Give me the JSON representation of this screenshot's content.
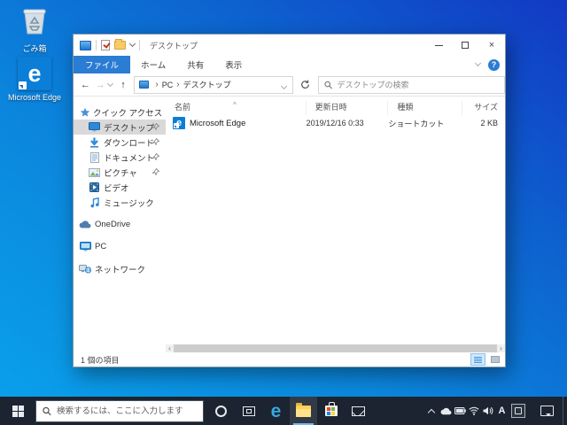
{
  "desktop": {
    "recycle_bin_label": "ごみ箱",
    "edge_label": "Microsoft Edge"
  },
  "explorer": {
    "title": "デスクトップ",
    "tabs": [
      {
        "label": "ファイル",
        "active": true
      },
      {
        "label": "ホーム",
        "active": false
      },
      {
        "label": "共有",
        "active": false
      },
      {
        "label": "表示",
        "active": false
      }
    ],
    "address": {
      "crumbs": [
        "PC",
        "デスクトップ"
      ],
      "search_placeholder": "デスクトップの検索"
    },
    "sidebar": {
      "items": [
        {
          "label": "クイック アクセス"
        },
        {
          "label": "デスクトップ",
          "selected": true,
          "pinned": true
        },
        {
          "label": "ダウンロード",
          "pinned": true
        },
        {
          "label": "ドキュメント",
          "pinned": true
        },
        {
          "label": "ピクチャ",
          "pinned": true
        },
        {
          "label": "ビデオ"
        },
        {
          "label": "ミュージック"
        },
        {
          "label": "OneDrive"
        },
        {
          "label": "PC"
        },
        {
          "label": "ネットワーク"
        }
      ]
    },
    "list": {
      "columns": [
        "名前",
        "更新日時",
        "種類",
        "サイズ"
      ],
      "rows": [
        {
          "name": "Microsoft Edge",
          "modified": "2019/12/16 0:33",
          "type": "ショートカット",
          "size": "2 KB"
        }
      ]
    },
    "status": {
      "item_count": "1 個の項目"
    }
  },
  "taskbar": {
    "search_placeholder": "検索するには、ここに入力します",
    "ime_mode": "A"
  },
  "icons": {
    "back": "←",
    "forward": "→",
    "up": "↑",
    "crumb_sep": "›",
    "sort_asc": "^",
    "scroll_left": "‹",
    "scroll_right": "›",
    "minimize": "–",
    "close": "×",
    "help": "?",
    "edge_letter": "e"
  },
  "colors": {
    "accent_tab": "#2b7cd3",
    "edge_tile": "#0b7ed7",
    "sidebar_selection": "#d9d9d9",
    "taskbar_bg": "#1b2430",
    "desktop_gradient_light": "#0aa2ec",
    "desktop_gradient_dark": "#1239c4"
  }
}
